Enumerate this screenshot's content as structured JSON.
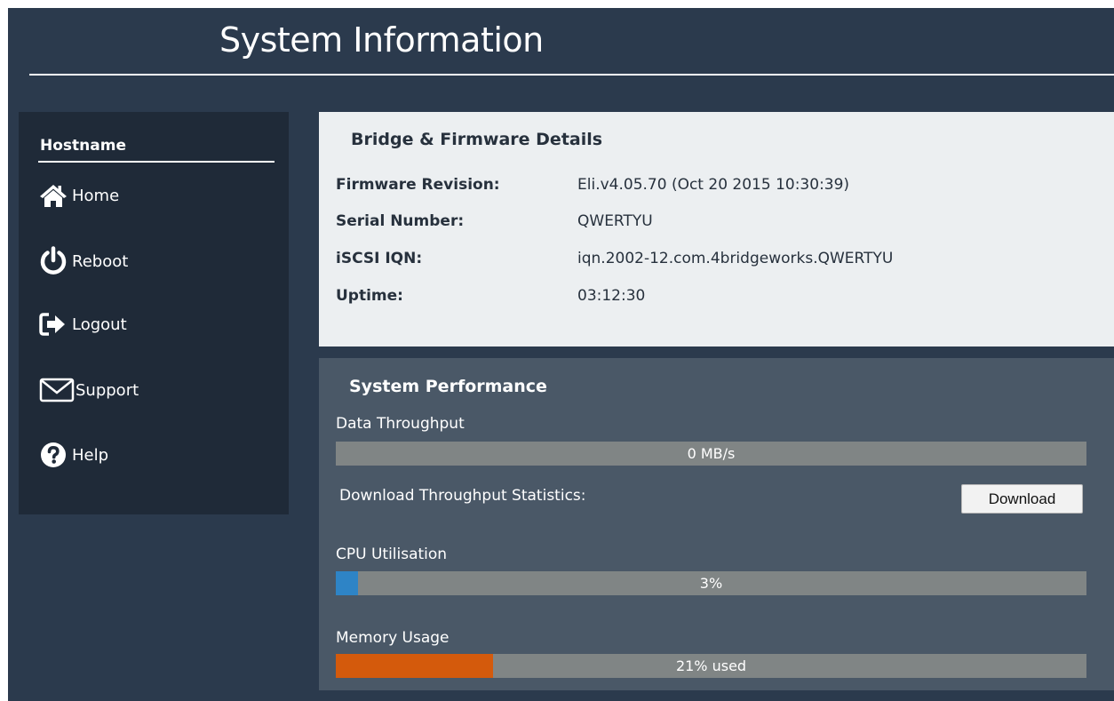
{
  "title": "System Information",
  "sidebar": {
    "hostname": "Hostname",
    "items": [
      {
        "label": "Home",
        "icon": "home-icon"
      },
      {
        "label": "Reboot",
        "icon": "power-icon"
      },
      {
        "label": "Logout",
        "icon": "logout-icon"
      },
      {
        "label": "Support",
        "icon": "envelope-icon"
      },
      {
        "label": "Help",
        "icon": "question-icon"
      }
    ]
  },
  "details": {
    "heading": "Bridge & Firmware Details",
    "rows": [
      {
        "label": "Firmware Revision:",
        "value": "Eli.v4.05.70 (Oct 20 2015 10:30:39)"
      },
      {
        "label": "Serial Number:",
        "value": "QWERTYU"
      },
      {
        "label": "iSCSI IQN:",
        "value": "iqn.2002-12.com.4bridgeworks.QWERTYU"
      },
      {
        "label": "Uptime:",
        "value": "03:12:30"
      }
    ]
  },
  "performance": {
    "heading": "System Performance",
    "throughput": {
      "label": "Data Throughput",
      "text": "0 MB/s",
      "fraction": 0
    },
    "download": {
      "label": "Download Throughput Statistics:",
      "button": "Download"
    },
    "cpu": {
      "label": "CPU Utilisation",
      "text": "3%",
      "fraction": 0.03,
      "color": "#2e84c6"
    },
    "memory": {
      "label": "Memory Usage",
      "text": "21% used",
      "fraction": 0.21,
      "color": "#d45a0c"
    }
  },
  "colors": {
    "background": "#2b3a4d",
    "sidebar": "#1f2a38",
    "details_panel": "#eceff1",
    "perf_panel": "#4a5867",
    "bar_track": "#808585"
  }
}
